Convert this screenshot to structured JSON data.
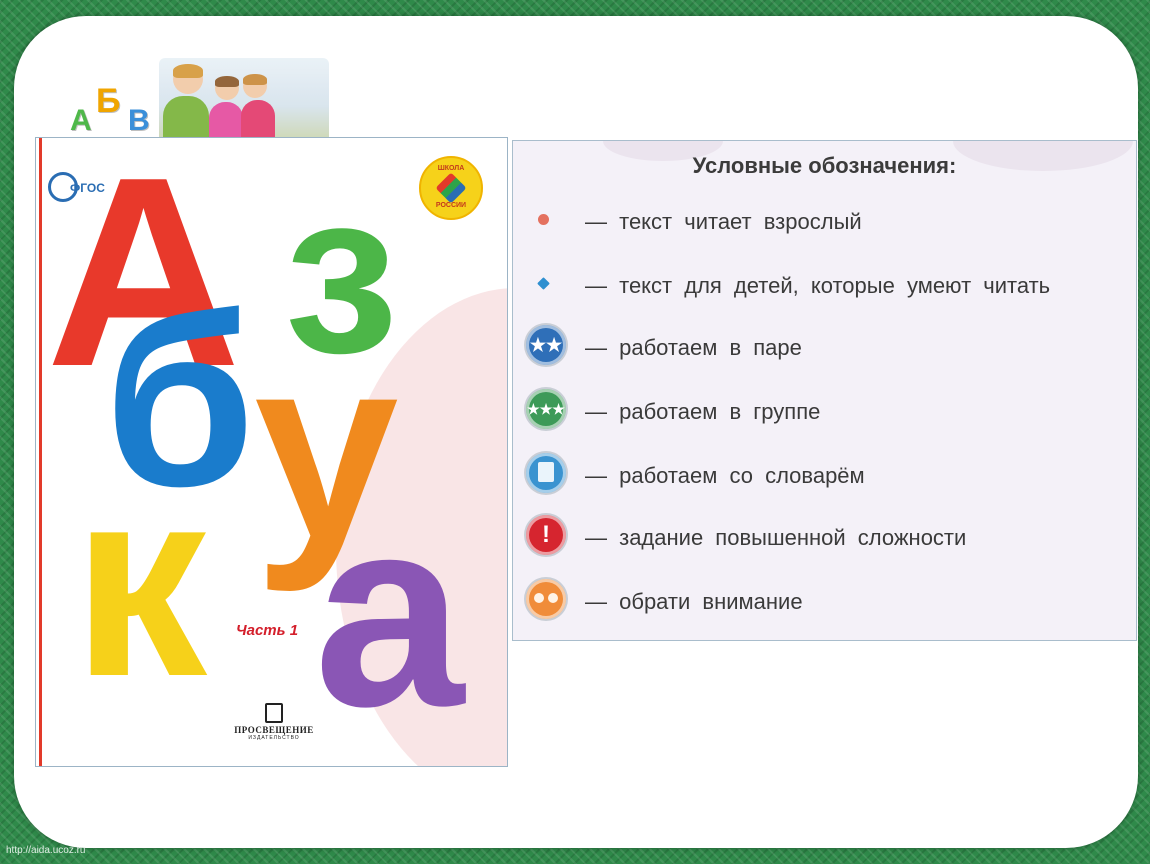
{
  "header": {
    "abc_letters": [
      "А",
      "Б",
      "В"
    ],
    "logo_colors": {
      "a": "#4fb84a",
      "b": "#f0a500",
      "v": "#3b8fd9"
    }
  },
  "cover": {
    "brand": "ФГОС",
    "school_badge": {
      "top": "ШКОЛА",
      "bottom": "РОССИИ"
    },
    "title_letters": [
      "А",
      "з",
      "б",
      "у",
      "к",
      "а"
    ],
    "title_colors": [
      "#e8392b",
      "#4cb648",
      "#1a7ccc",
      "#f08a1e",
      "#f6d11a",
      "#8a56b5"
    ],
    "part_label": "Часть 1",
    "publisher": {
      "name": "ПРОСВЕЩЕНИЕ",
      "sub": "ИЗДАТЕЛЬСТВО"
    }
  },
  "legend": {
    "title": "Условные обозначения:",
    "items": [
      {
        "marker": "red-dot",
        "color": "#e4715f",
        "text": "— текст читает взрослый"
      },
      {
        "marker": "blue-diamond",
        "color": "#2e8fd0",
        "text": "— текст для детей, которые умеют читать"
      },
      {
        "marker": "pair-icon",
        "color": "#2f6fb8",
        "text": "— работаем в паре"
      },
      {
        "marker": "group-icon",
        "color": "#3d9a58",
        "text": "— работаем в группе"
      },
      {
        "marker": "dictionary-icon",
        "color": "#3a93d0",
        "text": "— работаем со словарём"
      },
      {
        "marker": "exclamation-icon",
        "color": "#d6252f",
        "text": "— задание повышенной сложности"
      },
      {
        "marker": "owl-icon",
        "color": "#f08c3a",
        "text": "— обрати внимание"
      }
    ]
  },
  "footer": {
    "url": "http://aida.ucoz.ru"
  }
}
